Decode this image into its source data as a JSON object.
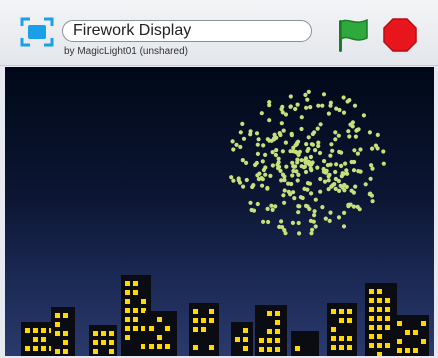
{
  "project": {
    "title": "Firework Display",
    "byline": "by MagicLight01 (unshared)"
  },
  "controls": {
    "fullscreen_icon": "fullscreen-icon",
    "green_flag_icon": "green-flag-icon",
    "stop_icon": "stop-sign-icon"
  },
  "colors": {
    "accent_blue": "#1aa0e8",
    "flag_green": "#2eaa3c",
    "stop_red": "#e8161c",
    "sky_top": "#000818",
    "sky_bottom": "#2a3a6c",
    "firework": "#c8e07c",
    "window": "#ffd800",
    "building": "#0b0b12"
  }
}
